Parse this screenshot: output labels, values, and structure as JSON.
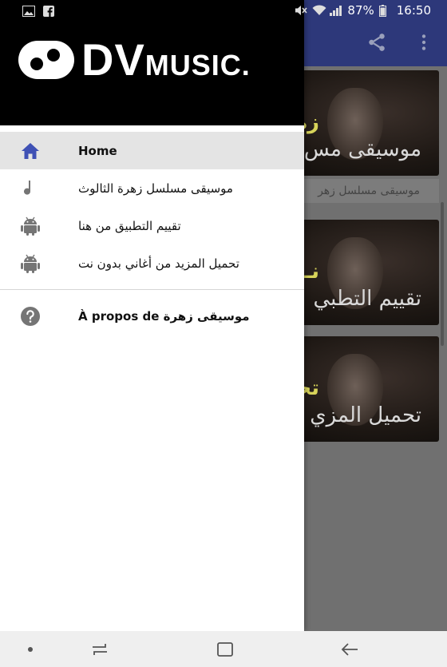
{
  "status_bar": {
    "battery": "87%",
    "time": "16:50",
    "icons": [
      "image-icon",
      "facebook-icon",
      "mute-icon",
      "wifi-icon",
      "signal-icon",
      "battery-icon"
    ]
  },
  "background_app": {
    "toolbar_color": "#3f51b5",
    "toolbar_icons": [
      "share-icon",
      "more-vert-icon"
    ],
    "cards": [
      {
        "badge": "زه",
        "overlay_text": "موسيقى مس",
        "caption": "موسيقى مسلسل زهر"
      },
      {
        "badge": "نـ",
        "overlay_text": "تقييم التطبي",
        "caption": ""
      },
      {
        "badge": "تحميل ا",
        "overlay_text": "تحميل المزي",
        "caption": ""
      }
    ]
  },
  "drawer": {
    "logo": {
      "big": "DV",
      "small": "MUSIC."
    },
    "items": [
      {
        "icon": "home-icon",
        "label": "Home",
        "selected": true
      },
      {
        "icon": "music-note-icon",
        "label": "موسيقى مسلسل زهرة الثالوث",
        "selected": false
      },
      {
        "icon": "android-icon",
        "label": "تقييم التطبيق من هنا",
        "selected": false
      },
      {
        "icon": "android-icon",
        "label": "تحميل المزيد من أغاني بدون نت",
        "selected": false
      }
    ],
    "about": {
      "icon": "help-icon",
      "label": "À propos de موسيقى زهرة"
    }
  },
  "nav_bar": {
    "icons": [
      "dot-icon",
      "recents-icon",
      "home-square-icon",
      "back-icon"
    ]
  },
  "colors": {
    "accent": "#3f51b5",
    "drawer_selected_bg": "#e4e4e4",
    "icon_grey": "#757575"
  }
}
